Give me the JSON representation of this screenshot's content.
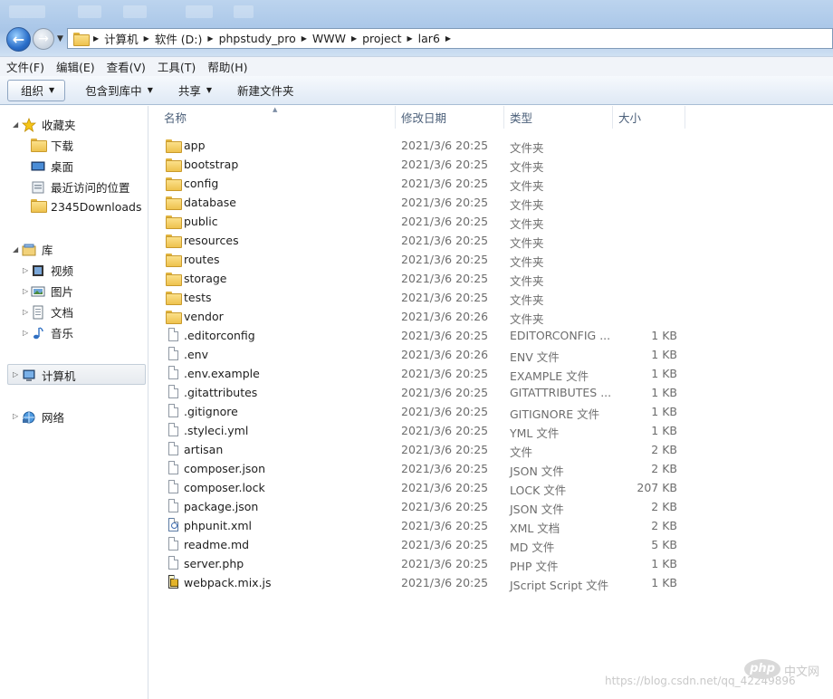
{
  "breadcrumb": [
    "计算机",
    "软件 (D:)",
    "phpstudy_pro",
    "WWW",
    "project",
    "lar6"
  ],
  "menu": [
    "文件(F)",
    "编辑(E)",
    "查看(V)",
    "工具(T)",
    "帮助(H)"
  ],
  "toolbar": {
    "organize": "组织",
    "include": "包含到库中",
    "share": "共享",
    "new_folder": "新建文件夹"
  },
  "nav": {
    "favorites": "收藏夹",
    "fav_items": [
      "下载",
      "桌面",
      "最近访问的位置",
      "2345Downloads"
    ],
    "libraries": "库",
    "lib_items": [
      "视频",
      "图片",
      "文档",
      "音乐"
    ],
    "computer": "计算机",
    "network": "网络"
  },
  "columns": {
    "name": "名称",
    "date": "修改日期",
    "type": "类型",
    "size": "大小"
  },
  "files": [
    {
      "name": "app",
      "date": "2021/3/6 20:25",
      "type": "文件夹",
      "size": "",
      "icon": "folder-icon"
    },
    {
      "name": "bootstrap",
      "date": "2021/3/6 20:25",
      "type": "文件夹",
      "size": "",
      "icon": "folder-icon"
    },
    {
      "name": "config",
      "date": "2021/3/6 20:25",
      "type": "文件夹",
      "size": "",
      "icon": "folder-icon"
    },
    {
      "name": "database",
      "date": "2021/3/6 20:25",
      "type": "文件夹",
      "size": "",
      "icon": "folder-icon"
    },
    {
      "name": "public",
      "date": "2021/3/6 20:25",
      "type": "文件夹",
      "size": "",
      "icon": "folder-icon"
    },
    {
      "name": "resources",
      "date": "2021/3/6 20:25",
      "type": "文件夹",
      "size": "",
      "icon": "folder-icon"
    },
    {
      "name": "routes",
      "date": "2021/3/6 20:25",
      "type": "文件夹",
      "size": "",
      "icon": "folder-icon"
    },
    {
      "name": "storage",
      "date": "2021/3/6 20:25",
      "type": "文件夹",
      "size": "",
      "icon": "folder-icon"
    },
    {
      "name": "tests",
      "date": "2021/3/6 20:25",
      "type": "文件夹",
      "size": "",
      "icon": "folder-icon"
    },
    {
      "name": "vendor",
      "date": "2021/3/6 20:26",
      "type": "文件夹",
      "size": "",
      "icon": "folder-icon"
    },
    {
      "name": ".editorconfig",
      "date": "2021/3/6 20:25",
      "type": "EDITORCONFIG ...",
      "size": "1 KB",
      "icon": "file-icon"
    },
    {
      "name": ".env",
      "date": "2021/3/6 20:26",
      "type": "ENV 文件",
      "size": "1 KB",
      "icon": "file-icon"
    },
    {
      "name": ".env.example",
      "date": "2021/3/6 20:25",
      "type": "EXAMPLE 文件",
      "size": "1 KB",
      "icon": "file-icon"
    },
    {
      "name": ".gitattributes",
      "date": "2021/3/6 20:25",
      "type": "GITATTRIBUTES ...",
      "size": "1 KB",
      "icon": "file-icon"
    },
    {
      "name": ".gitignore",
      "date": "2021/3/6 20:25",
      "type": "GITIGNORE 文件",
      "size": "1 KB",
      "icon": "file-icon"
    },
    {
      "name": ".styleci.yml",
      "date": "2021/3/6 20:25",
      "type": "YML 文件",
      "size": "1 KB",
      "icon": "file-icon"
    },
    {
      "name": "artisan",
      "date": "2021/3/6 20:25",
      "type": "文件",
      "size": "2 KB",
      "icon": "file-icon"
    },
    {
      "name": "composer.json",
      "date": "2021/3/6 20:25",
      "type": "JSON 文件",
      "size": "2 KB",
      "icon": "file-icon"
    },
    {
      "name": "composer.lock",
      "date": "2021/3/6 20:25",
      "type": "LOCK 文件",
      "size": "207 KB",
      "icon": "file-icon"
    },
    {
      "name": "package.json",
      "date": "2021/3/6 20:25",
      "type": "JSON 文件",
      "size": "2 KB",
      "icon": "file-icon"
    },
    {
      "name": "phpunit.xml",
      "date": "2021/3/6 20:25",
      "type": "XML 文档",
      "size": "2 KB",
      "icon": "xml-file-icon"
    },
    {
      "name": "readme.md",
      "date": "2021/3/6 20:25",
      "type": "MD 文件",
      "size": "5 KB",
      "icon": "file-icon"
    },
    {
      "name": "server.php",
      "date": "2021/3/6 20:25",
      "type": "PHP 文件",
      "size": "1 KB",
      "icon": "file-icon"
    },
    {
      "name": "webpack.mix.js",
      "date": "2021/3/6 20:25",
      "type": "JScript Script 文件",
      "size": "1 KB",
      "icon": "js-file-icon"
    }
  ],
  "watermark": "https://blog.csdn.net/qq_42249896",
  "logo": {
    "php": "php",
    "cn": "中文网"
  }
}
